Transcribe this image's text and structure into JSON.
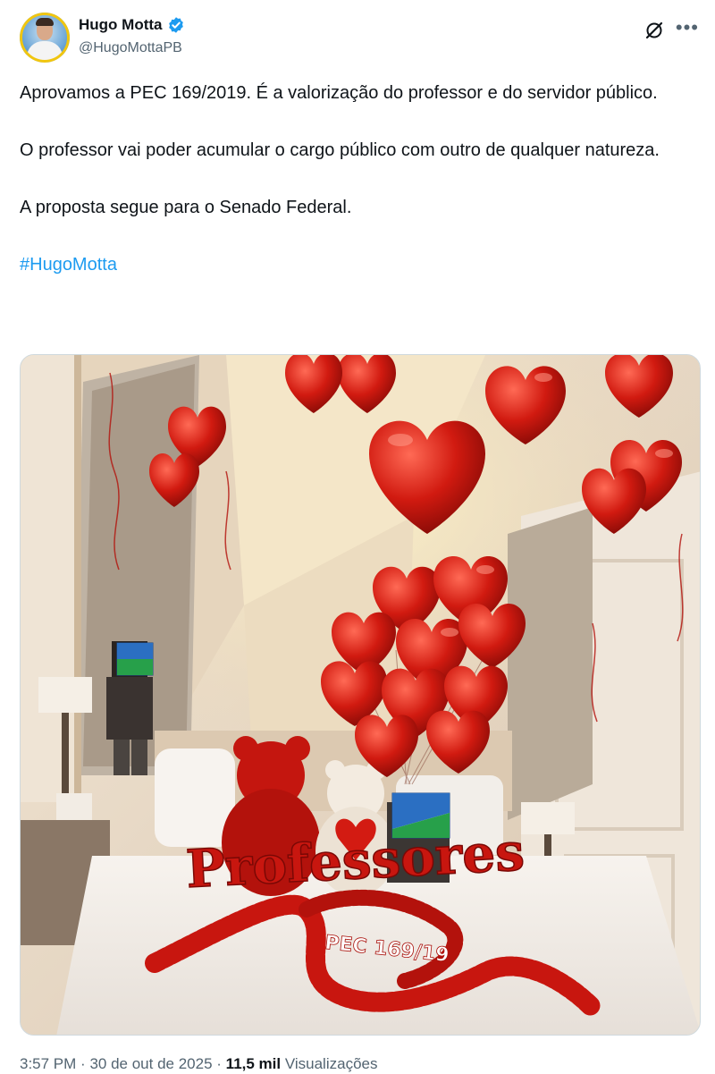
{
  "author": {
    "name": "Hugo Motta",
    "handle": "@HugoMottaPB",
    "verified": true
  },
  "tweet": {
    "paragraphs": [
      "Aprovamos a PEC 169/2019. É a valorização do professor e do servidor público.",
      "O professor vai poder acumular o cargo público com outro de qualquer natureza.",
      "A proposta segue para o Senado Federal."
    ],
    "hashtag": "#HugoMotta"
  },
  "media": {
    "balloon_letters": "Professores",
    "petal_text": "PEC 169/19"
  },
  "meta": {
    "time": "3:57 PM",
    "separator": "·",
    "date": "30 de out de 2025",
    "views_count": "11,5 mil",
    "views_label": "Visualizações"
  },
  "colors": {
    "accent": "#1d9bf0",
    "text_primary": "#0f1419",
    "text_secondary": "#536471",
    "verified": "#1d9bf0",
    "balloon_red": "#c8160f"
  }
}
